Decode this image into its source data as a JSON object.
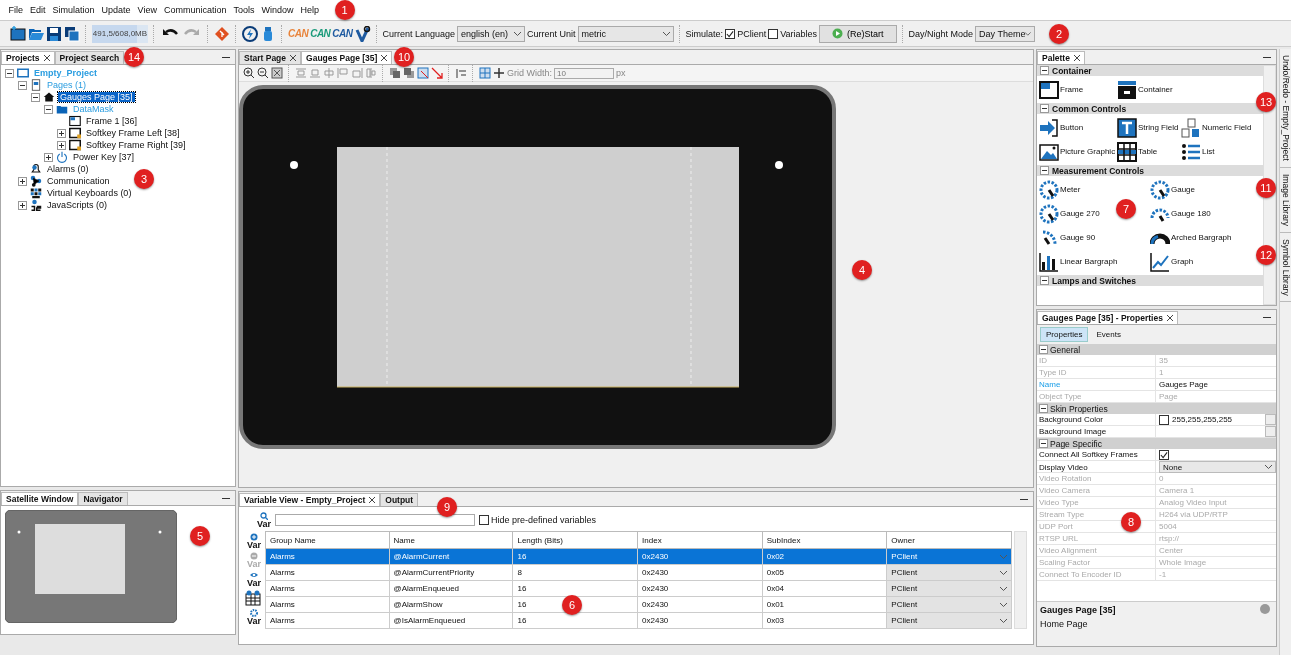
{
  "menu": {
    "items": [
      "File",
      "Edit",
      "Simulation",
      "Update",
      "View",
      "Communication",
      "Tools",
      "Window",
      "Help"
    ],
    "callout": "1"
  },
  "toolbar": {
    "memory": {
      "text": "491,5/608,0MB",
      "level": 0.81
    },
    "can_logos": [
      {
        "label": "CAN",
        "color": "#e8833a"
      },
      {
        "label": "CAN",
        "color": "#1a9a7a"
      },
      {
        "label": "CAN",
        "color": "#1e5aa0"
      }
    ],
    "language": {
      "label": "Current Language",
      "value": "english (en)"
    },
    "unit": {
      "label": "Current Unit",
      "value": "metric"
    },
    "simulate": {
      "label": "Simulate:",
      "options": [
        {
          "label": "PClient",
          "checked": true
        },
        {
          "label": "Variables",
          "checked": false
        }
      ]
    },
    "restart": "(Re)Start",
    "day_night": {
      "label": "Day/Night Mode",
      "value": "Day Theme"
    },
    "callout": "2"
  },
  "projects": {
    "tabs": [
      {
        "label": "Projects",
        "selected": true
      },
      {
        "label": "Project Search",
        "selected": false
      }
    ],
    "callout": "14",
    "tree": [
      {
        "label": "Empty_Project",
        "kind": "project",
        "highlight": true,
        "selected": false,
        "expanded": true,
        "children": [
          {
            "label": "Pages (1)",
            "kind": "pages",
            "highlight": true,
            "selected": false,
            "expanded": true,
            "children": [
              {
                "label": "Gauges Page [35]",
                "kind": "page",
                "highlight": false,
                "selected": true,
                "expanded": true,
                "children": [
                  {
                    "label": "DataMask",
                    "kind": "mask",
                    "highlight": true,
                    "selected": false,
                    "expanded": true,
                    "children": [
                      {
                        "label": "Frame 1 [36]",
                        "kind": "frame",
                        "highlight": false,
                        "selected": false
                      },
                      {
                        "label": "Softkey Frame Left [38]",
                        "kind": "softkey",
                        "highlight": false,
                        "selected": false,
                        "expanded": false
                      },
                      {
                        "label": "Softkey Frame Right [39]",
                        "kind": "softkey",
                        "highlight": false,
                        "selected": false,
                        "expanded": false
                      }
                    ]
                  },
                  {
                    "label": "Power Key [37]",
                    "kind": "power",
                    "highlight": false,
                    "selected": false,
                    "expanded": false
                  }
                ]
              }
            ]
          },
          {
            "label": "Alarms (0)",
            "kind": "alarms",
            "highlight": false,
            "selected": false
          },
          {
            "label": "Communication",
            "kind": "communication",
            "highlight": false,
            "selected": false,
            "expanded": false
          },
          {
            "label": "Virtual Keyboards (0)",
            "kind": "keyboard",
            "highlight": false,
            "selected": false
          },
          {
            "label": "JavaScripts (0)",
            "kind": "script",
            "highlight": false,
            "selected": false,
            "expanded": false
          }
        ]
      }
    ],
    "tree_callout": "3"
  },
  "satellite": {
    "tabs": [
      {
        "label": "Satellite Window",
        "selected": true
      },
      {
        "label": "Navigator",
        "selected": false
      }
    ],
    "callout": "5"
  },
  "editor": {
    "tabs": [
      {
        "label": "Start Page",
        "selected": false
      },
      {
        "label": "Gauges Page [35]",
        "selected": true
      }
    ],
    "callout": "10",
    "grid_label": "Grid Width:",
    "grid_value": "10",
    "grid_unit": "px",
    "canvas_callout": "4"
  },
  "variables": {
    "tabs": [
      {
        "label": "Variable View - Empty_Project",
        "selected": true
      },
      {
        "label": "Output",
        "selected": false
      }
    ],
    "callout": "9",
    "search_label": "Var",
    "hide_predefined": {
      "label": "Hide pre-defined variables",
      "checked": false
    },
    "side_tools": [
      {
        "kind": "add",
        "label": "Var"
      },
      {
        "kind": "remove",
        "label": "Var"
      },
      {
        "kind": "view",
        "label": "Var"
      },
      {
        "kind": "table"
      },
      {
        "kind": "settings",
        "label": "Var"
      }
    ],
    "columns": [
      "Group Name",
      "Name",
      "Length (Bits)",
      "Index",
      "SubIndex",
      "Owner"
    ],
    "rows": [
      {
        "cells": [
          "Alarms",
          "@AlarmCurrent",
          "16",
          "0x2430",
          "0x02",
          "PClient"
        ],
        "selected": true
      },
      {
        "cells": [
          "Alarms",
          "@AlarmCurrentPriority",
          "8",
          "0x2430",
          "0x05",
          "PClient"
        ],
        "selected": false
      },
      {
        "cells": [
          "Alarms",
          "@AlarmEnqueued",
          "16",
          "0x2430",
          "0x04",
          "PClient"
        ],
        "selected": false
      },
      {
        "cells": [
          "Alarms",
          "@AlarmShow",
          "16",
          "0x2430",
          "0x01",
          "PClient"
        ],
        "selected": false
      },
      {
        "cells": [
          "Alarms",
          "@IsAlarmEnqueued",
          "16",
          "0x2430",
          "0x03",
          "PClient"
        ],
        "selected": false
      }
    ],
    "table_callout": "6"
  },
  "palette": {
    "tab": "Palette",
    "callout": "7",
    "sections": [
      {
        "title": "Container",
        "expanded": true,
        "items": [
          {
            "label": "Frame",
            "kind": "frame"
          },
          {
            "label": "Container",
            "kind": "container"
          }
        ]
      },
      {
        "title": "Common Controls",
        "expanded": true,
        "items": [
          {
            "label": "Button",
            "kind": "button"
          },
          {
            "label": "String Field",
            "kind": "string"
          },
          {
            "label": "Numeric Field",
            "kind": "numeric"
          },
          {
            "label": "Picture Graphic",
            "kind": "picture"
          },
          {
            "label": "Table",
            "kind": "table"
          },
          {
            "label": "List",
            "kind": "list"
          }
        ]
      },
      {
        "title": "Measurement Controls",
        "expanded": true,
        "items": [
          {
            "label": "Meter",
            "kind": "gauge"
          },
          {
            "label": "Gauge",
            "kind": "gauge"
          },
          {
            "label": "Gauge 270",
            "kind": "gauge"
          },
          {
            "label": "Gauge 180",
            "kind": "gauge180"
          },
          {
            "label": "Gauge 90",
            "kind": "gauge90"
          },
          {
            "label": "Arched Bargraph",
            "kind": "arched"
          },
          {
            "label": "Linear Bargraph",
            "kind": "linear"
          },
          {
            "label": "Graph",
            "kind": "graph"
          }
        ]
      },
      {
        "title": "Lamps and Switches",
        "expanded": true
      }
    ]
  },
  "side_tabs": [
    {
      "label": "Undo/Redo - Empty_Project",
      "callout": "13"
    },
    {
      "label": "Image Library",
      "callout": "11"
    },
    {
      "label": "Symbol Library",
      "callout": "12"
    }
  ],
  "properties": {
    "tab": "Gauges Page [35] - Properties",
    "callout": "8",
    "subtabs": [
      {
        "label": "Properties",
        "selected": true
      },
      {
        "label": "Events",
        "selected": false
      }
    ],
    "groups": [
      {
        "title": "General",
        "expanded": true,
        "rows": [
          {
            "name": "ID",
            "value": "35",
            "kind": "text",
            "disabled": true,
            "selected": false
          },
          {
            "name": "Type ID",
            "value": "1",
            "kind": "text",
            "disabled": true,
            "selected": false
          },
          {
            "name": "Name",
            "value": "Gauges Page",
            "kind": "text",
            "disabled": false,
            "selected": true
          },
          {
            "name": "Object Type",
            "value": "Page",
            "kind": "text",
            "disabled": true,
            "selected": false
          }
        ]
      },
      {
        "title": "Skin Properties",
        "expanded": true,
        "rows": [
          {
            "name": "Background Color",
            "value": "255,255,255,255",
            "kind": "color",
            "color": "#ffffff",
            "disabled": false,
            "selected": false
          },
          {
            "name": "Background Image",
            "kind": "browse",
            "disabled": false,
            "selected": false
          }
        ]
      },
      {
        "title": "Page Specific",
        "expanded": true,
        "rows": [
          {
            "name": "Connect All Softkey Frames",
            "kind": "checkbox",
            "checked": true,
            "disabled": false,
            "selected": false
          },
          {
            "name": "Display Video",
            "value": "None",
            "kind": "select",
            "disabled": false,
            "selected": false
          },
          {
            "name": "Video Rotation",
            "value": "0",
            "kind": "text",
            "disabled": true,
            "selected": false
          },
          {
            "name": "Video Camera",
            "value": "Camera 1",
            "kind": "text",
            "disabled": true,
            "selected": false
          },
          {
            "name": "Video Type",
            "value": "Analog Video Input",
            "kind": "text",
            "disabled": true,
            "selected": false
          },
          {
            "name": "Stream Type",
            "value": "H264 via UDP/RTP",
            "kind": "text",
            "disabled": true,
            "selected": false
          },
          {
            "name": "UDP Port",
            "value": "5004",
            "kind": "text",
            "disabled": true,
            "selected": false
          },
          {
            "name": "RTSP URL",
            "value": "rtsp://",
            "kind": "text",
            "disabled": true,
            "selected": false
          },
          {
            "name": "Video Alignment",
            "value": "Center",
            "kind": "text",
            "disabled": true,
            "selected": false
          },
          {
            "name": "Scaling Factor",
            "value": "Whole Image",
            "kind": "text",
            "disabled": true,
            "selected": false
          },
          {
            "name": "Connect To Encoder ID",
            "value": "-1",
            "kind": "text",
            "disabled": true,
            "selected": false
          }
        ]
      }
    ],
    "footer_title": "Gauges Page [35]",
    "footer_text": "Home Page"
  }
}
